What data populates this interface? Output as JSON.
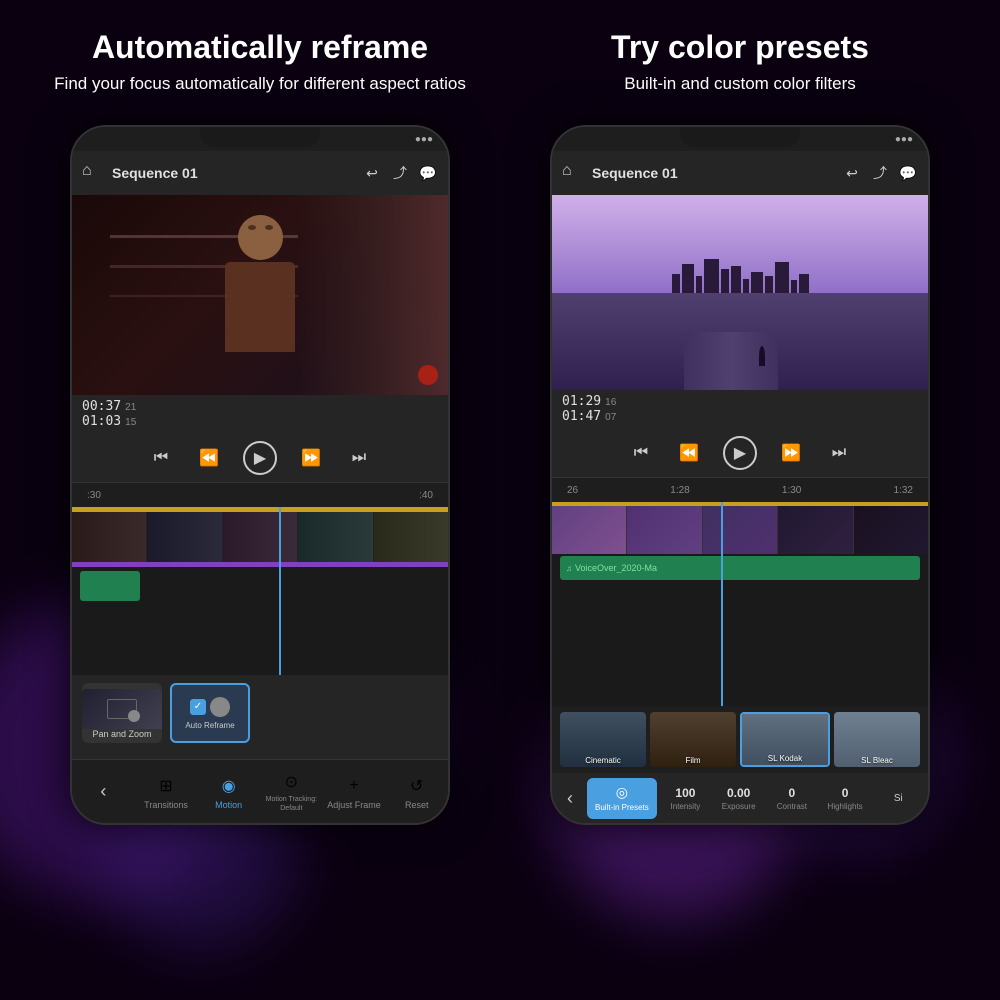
{
  "header": {
    "left_title": "Automatically reframe",
    "left_subtitle": "Find your focus automatically for different aspect ratios",
    "right_title": "Try color presets",
    "right_subtitle": "Built-in and custom color filters"
  },
  "phone_left": {
    "sequence_title": "Sequence 01",
    "time_current": "00:37",
    "time_frame_current": "21",
    "time_total": "01:03",
    "time_frame_total": "15",
    "ruler_marks": [
      ":30",
      ":40"
    ],
    "bottom_nav": [
      {
        "label": "Transitions",
        "icon": "⊞"
      },
      {
        "label": "Motion",
        "icon": "◉"
      },
      {
        "label": "Motion Tracking: Default",
        "icon": "⊙"
      },
      {
        "label": "Adjust Frame",
        "icon": "+"
      },
      {
        "label": "Reset",
        "icon": "↺"
      }
    ],
    "tool_presets": [
      {
        "label": "Pan and Zoom"
      },
      {
        "label": "Auto Reframe"
      }
    ]
  },
  "phone_right": {
    "sequence_title": "Sequence 01",
    "time_current": "01:29",
    "time_frame_current": "16",
    "time_total": "01:47",
    "time_frame_total": "07",
    "ruler_marks": [
      "26",
      "1:28",
      "1:30",
      "1:32"
    ],
    "audio_track_label": "VoiceOver_2020-Ma",
    "color_presets": [
      {
        "label": "Cinematic",
        "color": "#304060"
      },
      {
        "label": "Film",
        "color": "#403020"
      },
      {
        "label": "SL Kodak",
        "color": "#506080"
      },
      {
        "label": "SL Bleac",
        "color": "#607090"
      }
    ],
    "adjustments": [
      {
        "label": "Intensity",
        "value": "100"
      },
      {
        "label": "Exposure",
        "value": "0.00"
      },
      {
        "label": "Contrast",
        "value": "0"
      },
      {
        "label": "Highlights",
        "value": "0"
      }
    ],
    "builtin_label": "Built-in Presets",
    "bottom_nav": [
      {
        "label": "Back",
        "icon": "‹"
      }
    ]
  },
  "icons": {
    "home": "⌂",
    "undo": "↩",
    "share": "⤴",
    "chat": "💬",
    "skip_back": "⏮",
    "step_back": "⏪",
    "play": "▶",
    "step_fwd": "⏩",
    "skip_fwd": "⏭",
    "check": "✓",
    "music_note": "♫"
  },
  "colors": {
    "bg": "#0a0010",
    "phone_bg": "#1e1e1e",
    "accent_blue": "#4a9fe0",
    "accent_orange": "#c8a020",
    "accent_purple": "#8040c0",
    "accent_green": "#208050",
    "bokeh1": "#6020a0",
    "bokeh2": "#402080",
    "bokeh3": "#8030c0"
  }
}
